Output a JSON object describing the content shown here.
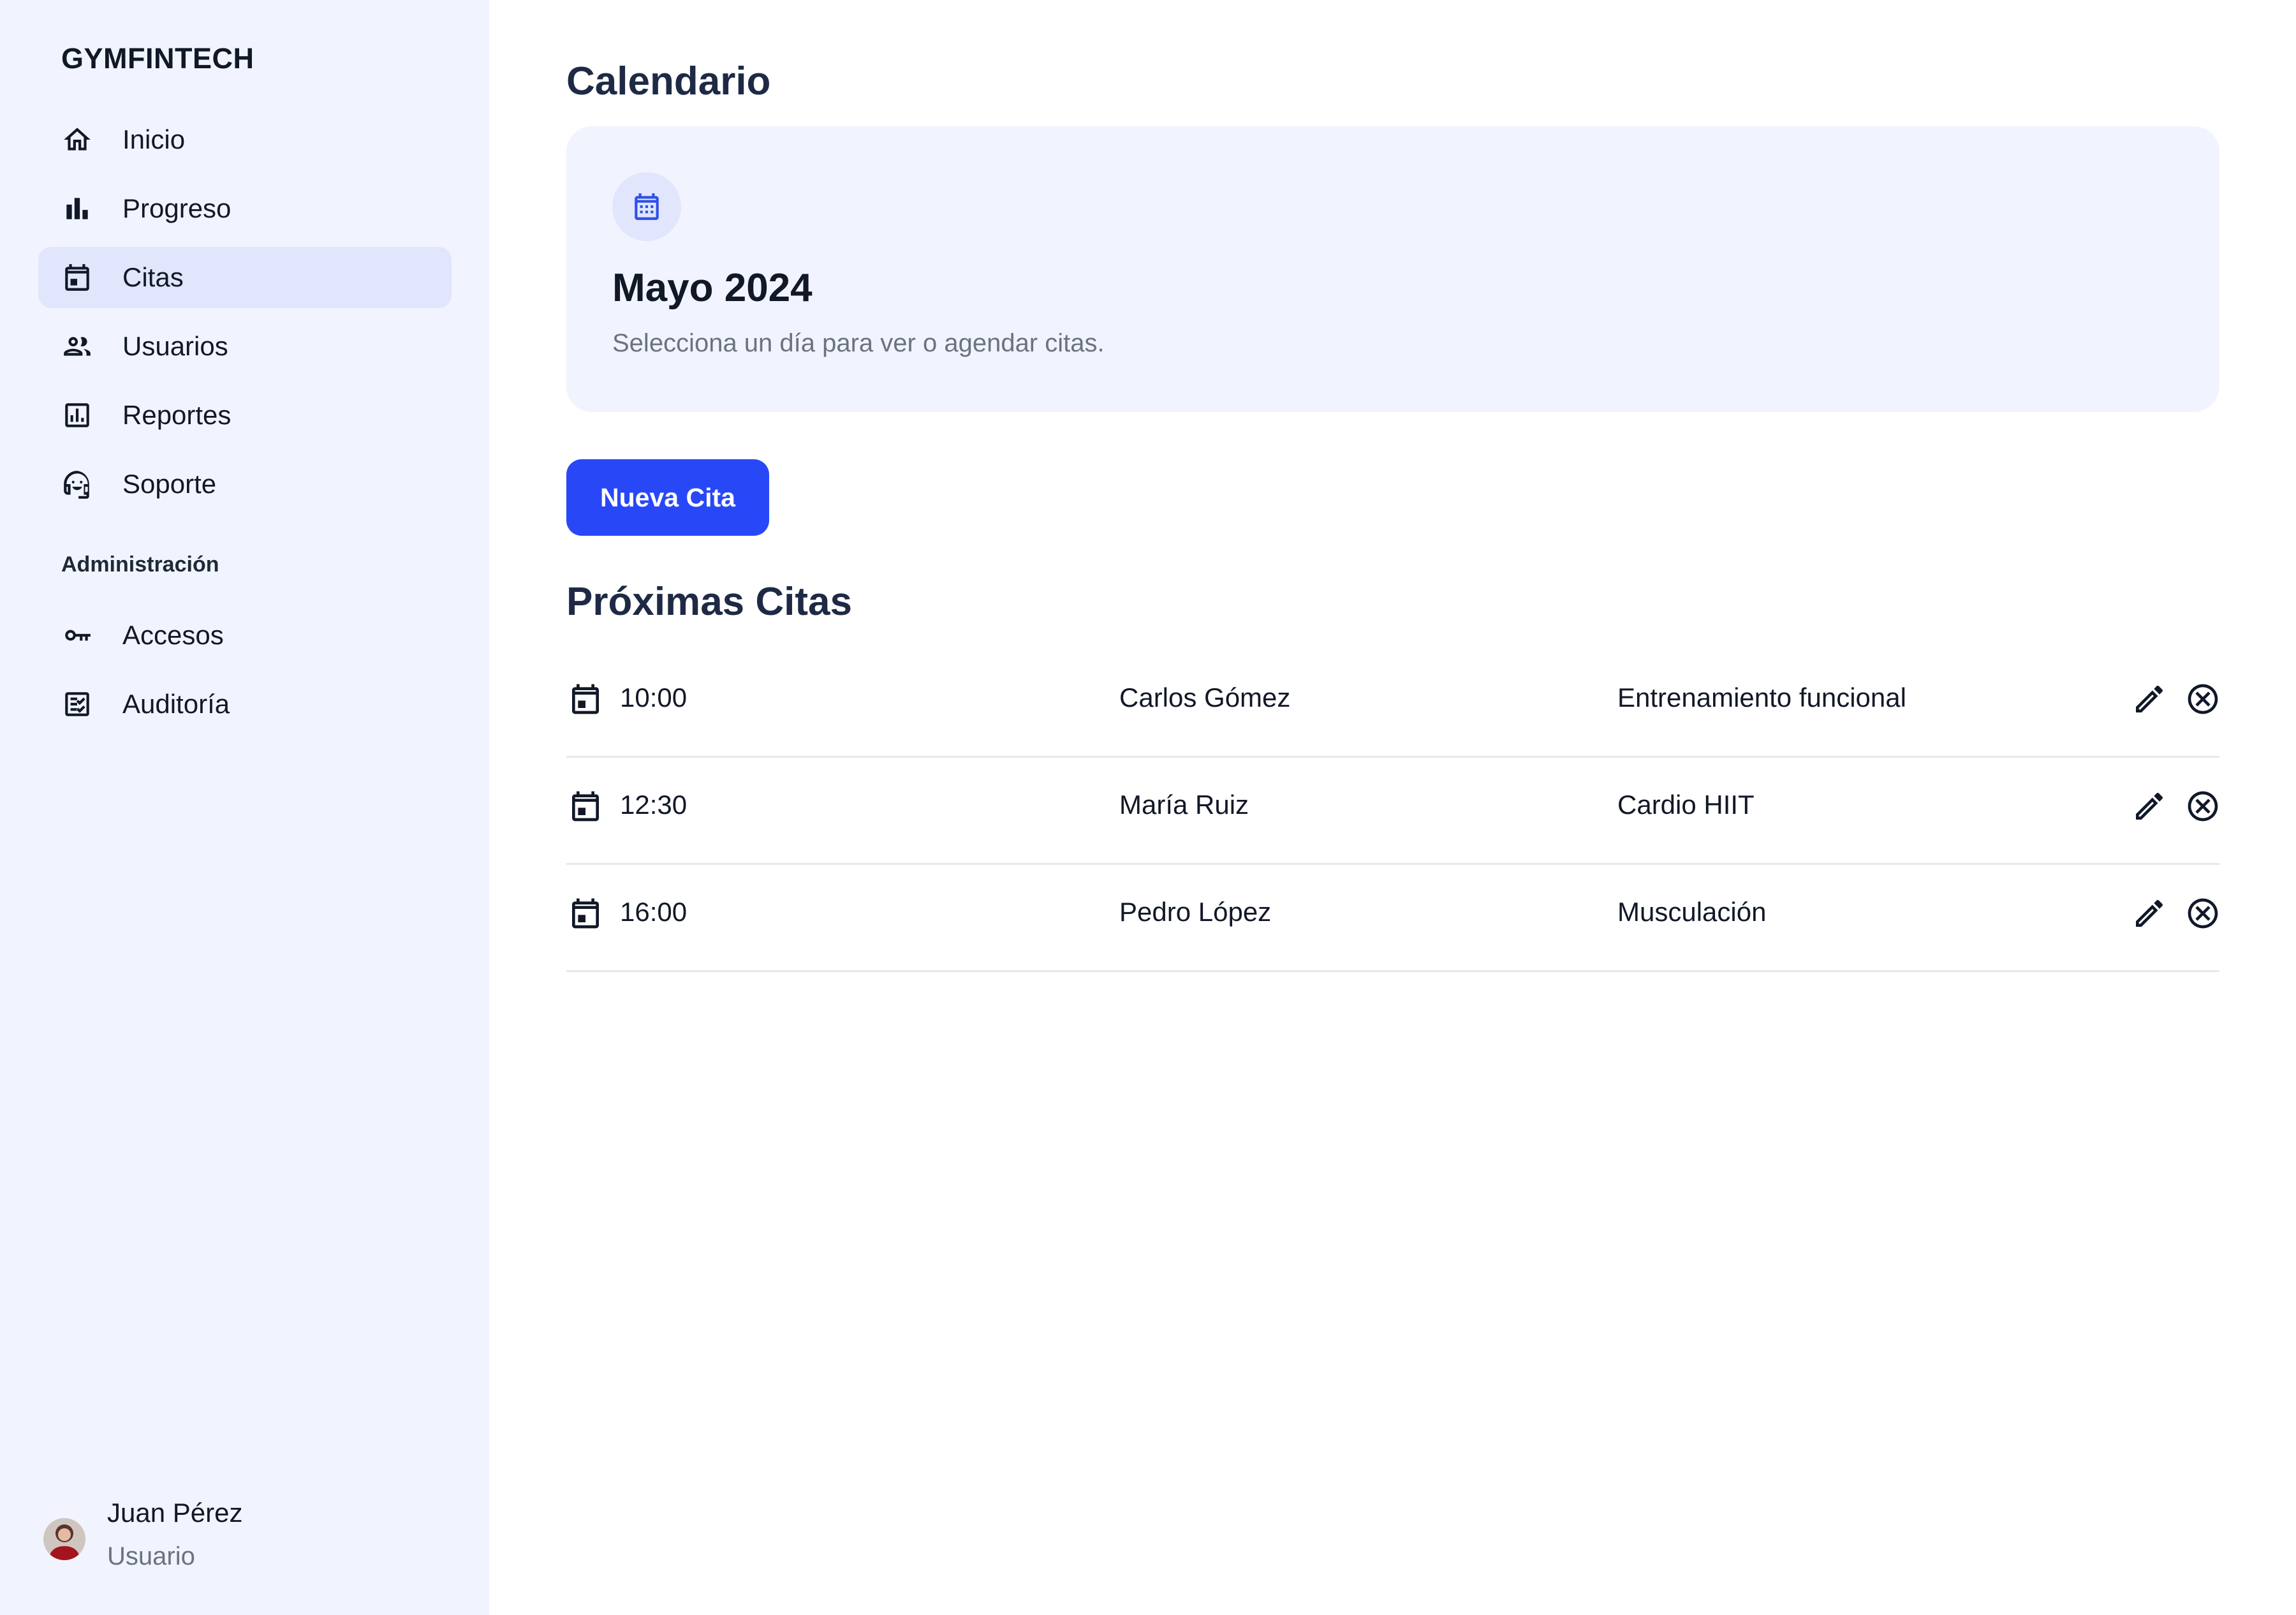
{
  "sidebar": {
    "brand": "GYMFINTECH",
    "items": [
      {
        "label": "Inicio",
        "icon": "home-icon"
      },
      {
        "label": "Progreso",
        "icon": "bar-chart-icon"
      },
      {
        "label": "Citas",
        "icon": "calendar-icon",
        "active": true
      },
      {
        "label": "Usuarios",
        "icon": "users-icon"
      },
      {
        "label": "Reportes",
        "icon": "report-icon"
      },
      {
        "label": "Soporte",
        "icon": "headset-icon"
      }
    ],
    "section_label": "Administración",
    "admin_items": [
      {
        "label": "Accesos",
        "icon": "key-icon"
      },
      {
        "label": "Auditoría",
        "icon": "checklist-icon"
      }
    ],
    "user": {
      "name": "Juan Pérez",
      "role": "Usuario"
    }
  },
  "main": {
    "title": "Calendario",
    "calendar_card": {
      "month": "Mayo 2024",
      "hint": "Selecciona un día para ver o agendar citas."
    },
    "new_button_label": "Nueva Cita",
    "upcoming_title": "Próximas Citas",
    "appointments": [
      {
        "time": "10:00",
        "client": "Carlos Gómez",
        "type": "Entrenamiento funcional"
      },
      {
        "time": "12:30",
        "client": "María Ruiz",
        "type": "Cardio HIIT"
      },
      {
        "time": "16:00",
        "client": "Pedro López",
        "type": "Musculación"
      }
    ]
  },
  "colors": {
    "sidebar_bg": "#f1f4fe",
    "active_bg": "#e1e6fd",
    "primary": "#2848f8",
    "heading": "#1e2a45",
    "muted": "#6b7280"
  }
}
